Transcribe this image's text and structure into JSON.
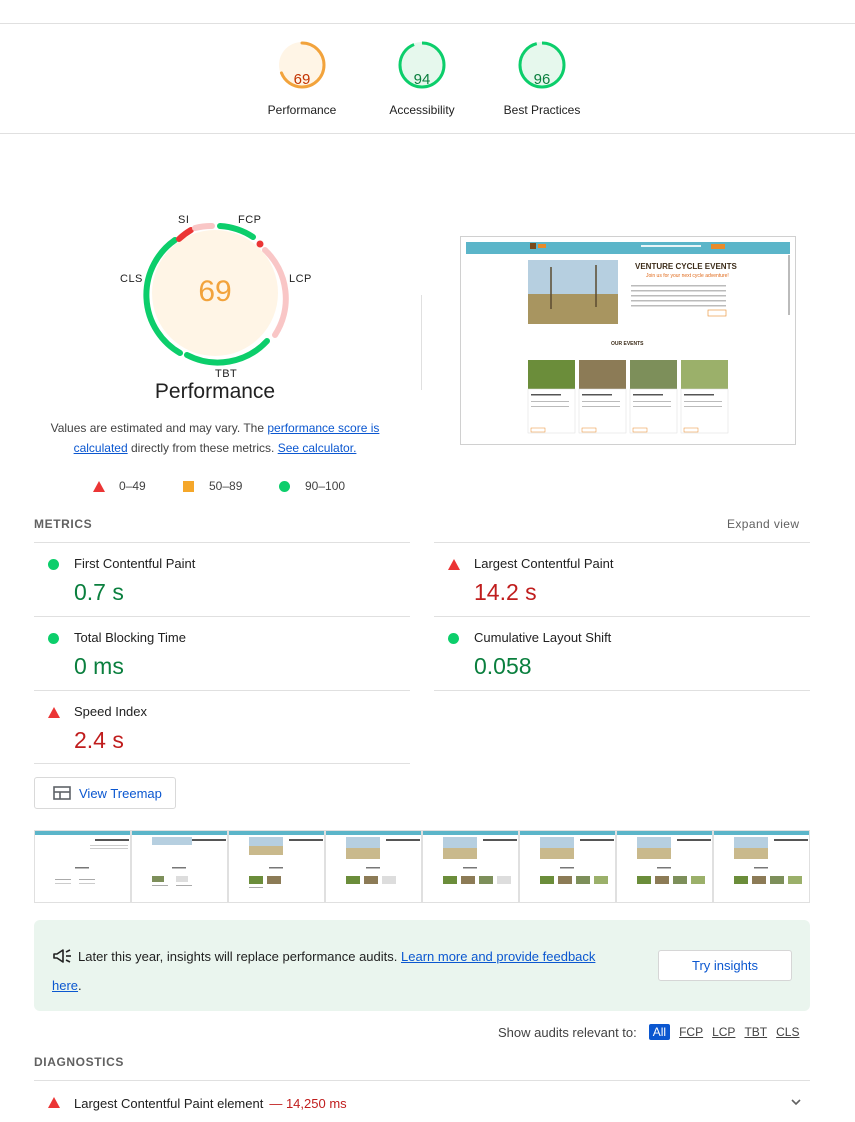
{
  "top_gauges": [
    {
      "score": "69",
      "label": "Performance",
      "fraction": 0.69,
      "color": "#f2a33c",
      "bg": "#fff5e6",
      "text_color": "#c33300"
    },
    {
      "score": "94",
      "label": "Accessibility",
      "fraction": 0.94,
      "color": "#0cce6b",
      "bg": "#e6f8ed",
      "text_color": "#0a7f3e"
    },
    {
      "score": "96",
      "label": "Best Practices",
      "fraction": 0.96,
      "color": "#0cce6b",
      "bg": "#e6f8ed",
      "text_color": "#0a7f3e"
    }
  ],
  "main_gauge": {
    "score": "69",
    "title": "Performance",
    "metric_labels": {
      "si": "SI",
      "fcp": "FCP",
      "lcp": "LCP",
      "tbt": "TBT",
      "cls": "CLS"
    }
  },
  "note": {
    "prefix": "Values are estimated and may vary. The ",
    "link1": "performance score is calculated",
    "middle": " directly from these metrics. ",
    "link2": "See calculator."
  },
  "legend": [
    {
      "shape": "triangle",
      "range": "0–49",
      "color": "#eb3535"
    },
    {
      "shape": "square",
      "range": "50–89",
      "color": "#f5a72a"
    },
    {
      "shape": "circle",
      "range": "90–100",
      "color": "#0cce6b"
    }
  ],
  "metrics_section": {
    "title": "METRICS",
    "expand": "Expand view",
    "items": [
      {
        "name": "First Contentful Paint",
        "value": "0.7 s",
        "status": "good"
      },
      {
        "name": "Largest Contentful Paint",
        "value": "14.2 s",
        "status": "poor"
      },
      {
        "name": "Total Blocking Time",
        "value": "0 ms",
        "status": "good"
      },
      {
        "name": "Cumulative Layout Shift",
        "value": "0.058",
        "status": "good"
      },
      {
        "name": "Speed Index",
        "value": "2.4 s",
        "status": "poor"
      }
    ]
  },
  "treemap_button": "View Treemap",
  "screenshot_preview": {
    "hero_title": "VENTURE CYCLE EVENTS",
    "hero_sub": "Join us for your next cycle adventure!",
    "events_title": "OUR EVENTS"
  },
  "banner": {
    "text": "Later this year, insights will replace performance audits. ",
    "link": "Learn more and provide feedback",
    "link_tail": "here",
    "end": ".",
    "button": "Try insights"
  },
  "filter": {
    "label": "Show audits relevant to:",
    "chips": [
      "All",
      "FCP",
      "LCP",
      "TBT",
      "CLS"
    ],
    "active": "All"
  },
  "diagnostics": {
    "title": "DIAGNOSTICS",
    "items": [
      {
        "name": "Largest Contentful Paint element",
        "value": "— 14,250 ms",
        "status": "poor"
      }
    ]
  },
  "colors": {
    "good": "#0cce6b",
    "average": "#f5a72a",
    "poor": "#eb3535",
    "link": "#0b57d0"
  }
}
